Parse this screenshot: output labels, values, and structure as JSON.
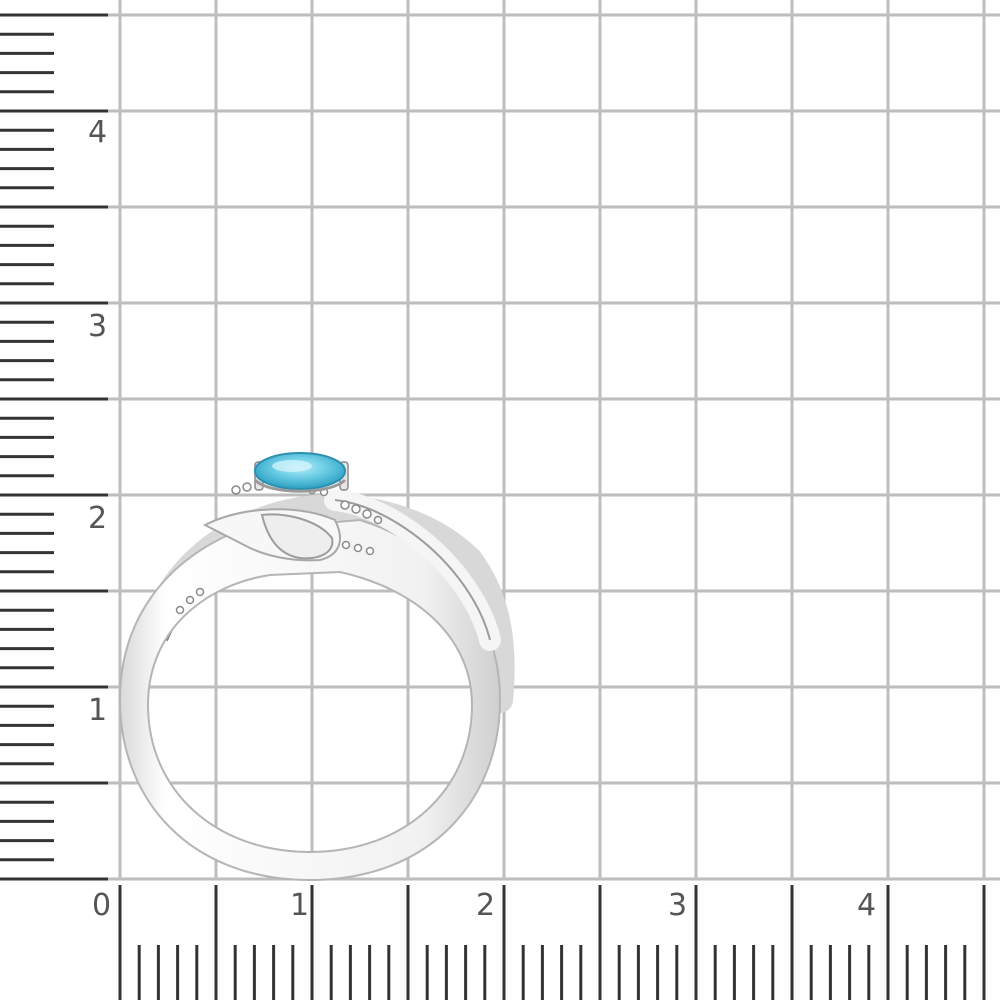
{
  "photo": {
    "subject": "ring-with-blue-gemstone",
    "metal_color": "#f2f2f2",
    "gem_color": "#5fc8e2",
    "grid_color": "#bdbdbd",
    "ruler_color": "#333333"
  },
  "ruler": {
    "y_labels": [
      "4",
      "3",
      "2",
      "1"
    ],
    "x_labels": [
      "0",
      "1",
      "2",
      "3",
      "4"
    ]
  }
}
